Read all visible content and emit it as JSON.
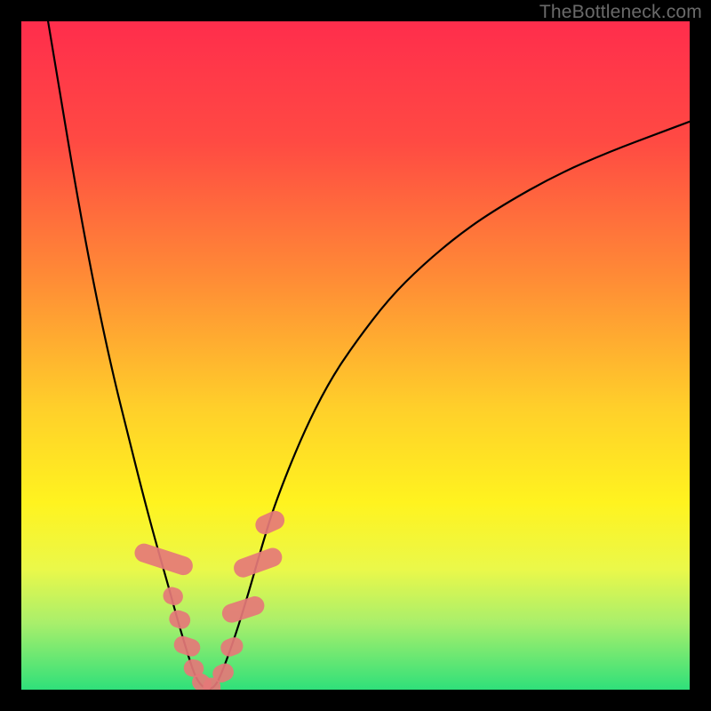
{
  "watermark": "TheBottleneck.com",
  "chart_data": {
    "type": "line",
    "title": "",
    "xlabel": "",
    "ylabel": "",
    "xlim": [
      0,
      100
    ],
    "ylim": [
      0,
      100
    ],
    "background_gradient": {
      "stops": [
        {
          "offset": 0.0,
          "color": "#ff2d4c"
        },
        {
          "offset": 0.18,
          "color": "#ff4a43"
        },
        {
          "offset": 0.38,
          "color": "#ff8a36"
        },
        {
          "offset": 0.58,
          "color": "#ffd02a"
        },
        {
          "offset": 0.72,
          "color": "#fff31f"
        },
        {
          "offset": 0.82,
          "color": "#eaf84a"
        },
        {
          "offset": 0.9,
          "color": "#a9ef6b"
        },
        {
          "offset": 1.0,
          "color": "#2fe07a"
        }
      ]
    },
    "series": [
      {
        "name": "left-branch",
        "stroke": "#000000",
        "strokeWidth": 2.2,
        "points": [
          {
            "x": 4.0,
            "y": 100.0
          },
          {
            "x": 6.0,
            "y": 88.0
          },
          {
            "x": 8.0,
            "y": 76.0
          },
          {
            "x": 10.0,
            "y": 65.0
          },
          {
            "x": 12.0,
            "y": 55.0
          },
          {
            "x": 14.0,
            "y": 46.0
          },
          {
            "x": 16.0,
            "y": 38.0
          },
          {
            "x": 18.0,
            "y": 30.0
          },
          {
            "x": 20.0,
            "y": 22.5
          },
          {
            "x": 22.0,
            "y": 15.5
          },
          {
            "x": 23.5,
            "y": 10.0
          },
          {
            "x": 25.0,
            "y": 5.0
          },
          {
            "x": 26.0,
            "y": 2.0
          },
          {
            "x": 27.0,
            "y": 0.5
          },
          {
            "x": 28.0,
            "y": 0.0
          }
        ]
      },
      {
        "name": "right-branch",
        "stroke": "#000000",
        "strokeWidth": 2.2,
        "points": [
          {
            "x": 28.0,
            "y": 0.0
          },
          {
            "x": 29.0,
            "y": 0.5
          },
          {
            "x": 30.0,
            "y": 2.5
          },
          {
            "x": 32.0,
            "y": 8.0
          },
          {
            "x": 34.0,
            "y": 14.5
          },
          {
            "x": 36.0,
            "y": 21.5
          },
          {
            "x": 38.0,
            "y": 28.0
          },
          {
            "x": 42.0,
            "y": 38.0
          },
          {
            "x": 46.0,
            "y": 46.0
          },
          {
            "x": 50.0,
            "y": 52.0
          },
          {
            "x": 55.0,
            "y": 58.5
          },
          {
            "x": 60.0,
            "y": 63.5
          },
          {
            "x": 66.0,
            "y": 68.5
          },
          {
            "x": 72.0,
            "y": 72.5
          },
          {
            "x": 80.0,
            "y": 77.0
          },
          {
            "x": 88.0,
            "y": 80.5
          },
          {
            "x": 96.0,
            "y": 83.5
          },
          {
            "x": 100.0,
            "y": 85.0
          }
        ]
      }
    ],
    "markers": {
      "fill": "#e57878",
      "shape": "rounded-rect",
      "rects": [
        {
          "cx": 21.3,
          "cy": 19.5,
          "w": 2.8,
          "h": 9.0,
          "angle": -72
        },
        {
          "cx": 22.7,
          "cy": 14.0,
          "w": 2.6,
          "h": 3.0,
          "angle": -72
        },
        {
          "cx": 23.7,
          "cy": 10.5,
          "w": 2.6,
          "h": 3.2,
          "angle": -72
        },
        {
          "cx": 24.8,
          "cy": 6.5,
          "w": 2.6,
          "h": 4.0,
          "angle": -72
        },
        {
          "cx": 25.8,
          "cy": 3.2,
          "w": 2.6,
          "h": 3.0,
          "angle": -78
        },
        {
          "cx": 27.0,
          "cy": 1.0,
          "w": 2.6,
          "h": 3.0,
          "angle": -50
        },
        {
          "cx": 28.5,
          "cy": 0.2,
          "w": 2.6,
          "h": 3.2,
          "angle": 0
        },
        {
          "cx": 30.2,
          "cy": 2.5,
          "w": 2.6,
          "h": 3.2,
          "angle": 65
        },
        {
          "cx": 31.5,
          "cy": 6.4,
          "w": 2.6,
          "h": 3.4,
          "angle": 70
        },
        {
          "cx": 33.2,
          "cy": 12.0,
          "w": 2.8,
          "h": 6.5,
          "angle": 72
        },
        {
          "cx": 35.4,
          "cy": 19.0,
          "w": 2.8,
          "h": 7.5,
          "angle": 70
        },
        {
          "cx": 37.2,
          "cy": 25.0,
          "w": 2.8,
          "h": 4.5,
          "angle": 66
        }
      ]
    }
  }
}
